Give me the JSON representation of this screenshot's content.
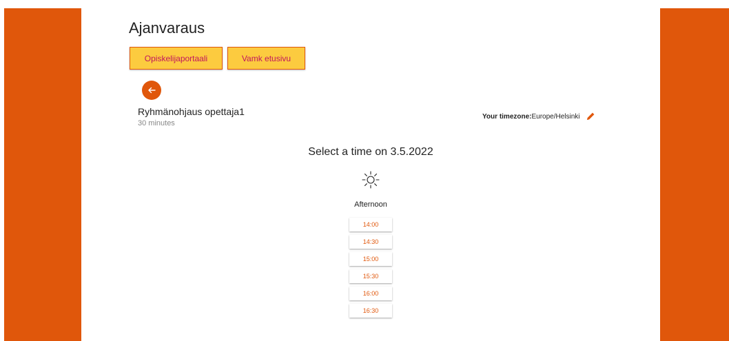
{
  "page": {
    "title": "Ajanvaraus"
  },
  "nav": {
    "student_portal": "Opiskelijaportaali",
    "vamk_home": "Vamk etusivu"
  },
  "event": {
    "name": "Ryhmänohjaus opettaja1",
    "duration": "30 minutes"
  },
  "timezone": {
    "label": "Your timezone:",
    "value": "Europe/Helsinki"
  },
  "selection": {
    "heading": "Select a time on 3.5.2022",
    "period": "Afternoon"
  },
  "slots": [
    "14:00",
    "14:30",
    "15:00",
    "15:30",
    "16:00",
    "16:30"
  ],
  "colors": {
    "accent": "#e0570b",
    "button_bg": "#fccb3f",
    "button_text": "#c0145f"
  },
  "icons": {
    "back": "arrow-left-icon",
    "edit": "pencil-icon",
    "period": "sun-icon"
  }
}
